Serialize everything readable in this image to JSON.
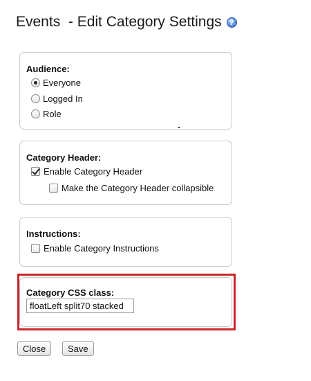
{
  "page": {
    "title": "Events  - Edit Category Settings",
    "help_icon": "help-icon"
  },
  "audience": {
    "label": "Audience:",
    "options": [
      {
        "label": "Everyone",
        "selected": true
      },
      {
        "label": "Logged In",
        "selected": false
      },
      {
        "label": "Role",
        "selected": false
      }
    ]
  },
  "category_header": {
    "label": "Category Header:",
    "enable_label": "Enable Category Header",
    "enable_checked": true,
    "collapsible_label": "Make the Category Header collapsible",
    "collapsible_checked": false
  },
  "instructions": {
    "label": "Instructions:",
    "enable_label": "Enable Category Instructions",
    "enable_checked": false
  },
  "css_class": {
    "label": "Category CSS class:",
    "value": "floatLeft split70 stacked",
    "highlight_color": "#c9272a"
  },
  "buttons": {
    "close_label": "Close",
    "save_label": "Save"
  }
}
